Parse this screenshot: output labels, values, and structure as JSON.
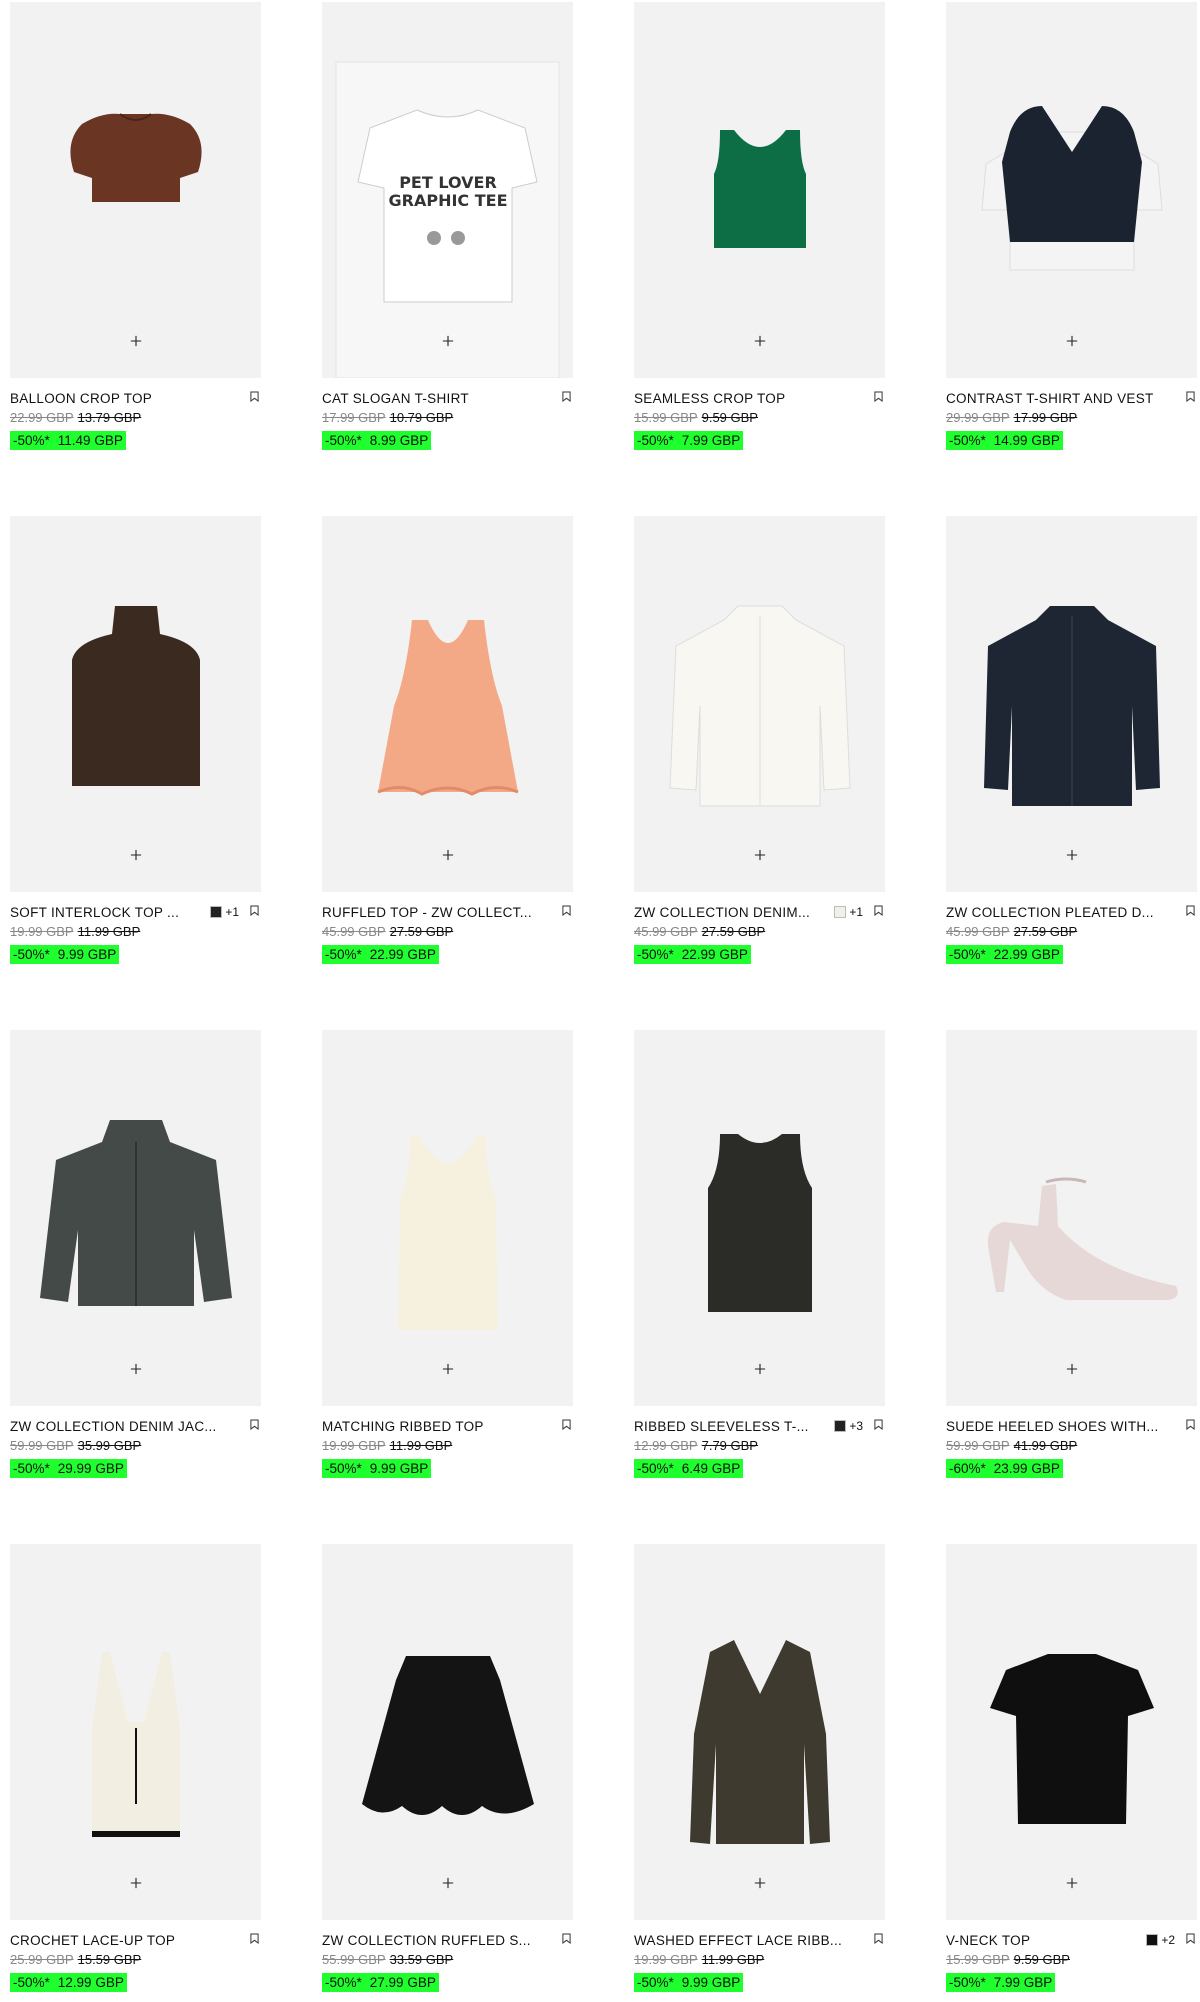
{
  "accent": "#1fff2d",
  "icons": {
    "add": "plus-icon",
    "bookmark": "bookmark-icon"
  },
  "add_label": "+",
  "products": [
    {
      "name": "BALLOON CROP TOP",
      "old1": "22.99 GBP",
      "old2": "13.79 GBP",
      "discount": "-50%*",
      "price": "11.49 GBP",
      "swatch": null,
      "colors": null,
      "art": "crop-top-brown"
    },
    {
      "name": "CAT SLOGAN T-SHIRT",
      "old1": "17.99 GBP",
      "old2": "10.79 GBP",
      "discount": "-50%*",
      "price": "8.99 GBP",
      "swatch": null,
      "colors": null,
      "art": "tshirt-white",
      "art_text": [
        "PET LOVER",
        "GRAPHIC TEE"
      ]
    },
    {
      "name": "SEAMLESS CROP TOP",
      "old1": "15.99 GBP",
      "old2": "9.59 GBP",
      "discount": "-50%*",
      "price": "7.99 GBP",
      "swatch": null,
      "colors": null,
      "art": "tank-green"
    },
    {
      "name": "CONTRAST T-SHIRT AND VEST",
      "old1": "29.99 GBP",
      "old2": "17.99 GBP",
      "discount": "-50%*",
      "price": "14.99 GBP",
      "swatch": null,
      "colors": null,
      "art": "vest-navy"
    },
    {
      "name": "SOFT INTERLOCK TOP ...",
      "old1": "19.99 GBP",
      "old2": "11.99 GBP",
      "discount": "-50%*",
      "price": "9.99 GBP",
      "swatch": "#222",
      "colors": "+1",
      "art": "sleeveless-brown"
    },
    {
      "name": "RUFFLED TOP - ZW COLLECT...",
      "old1": "45.99 GBP",
      "old2": "27.59 GBP",
      "discount": "-50%*",
      "price": "22.99 GBP",
      "swatch": null,
      "colors": null,
      "art": "ruffle-peach"
    },
    {
      "name": "ZW COLLECTION DENIM...",
      "old1": "45.99 GBP",
      "old2": "27.59 GBP",
      "discount": "-50%*",
      "price": "22.99 GBP",
      "swatch": "#f1efe8",
      "colors": "+1",
      "art": "shirt-white"
    },
    {
      "name": "ZW COLLECTION PLEATED D...",
      "old1": "45.99 GBP",
      "old2": "27.59 GBP",
      "discount": "-50%*",
      "price": "22.99 GBP",
      "swatch": null,
      "colors": null,
      "art": "shirt-navy"
    },
    {
      "name": "ZW COLLECTION DENIM JAC...",
      "old1": "59.99 GBP",
      "old2": "35.99 GBP",
      "discount": "-50%*",
      "price": "29.99 GBP",
      "swatch": null,
      "colors": null,
      "art": "jacket-grey"
    },
    {
      "name": "MATCHING RIBBED TOP",
      "old1": "19.99 GBP",
      "old2": "11.99 GBP",
      "discount": "-50%*",
      "price": "9.99 GBP",
      "swatch": null,
      "colors": null,
      "art": "tank-cream"
    },
    {
      "name": "RIBBED SLEEVELESS T-...",
      "old1": "12.99 GBP",
      "old2": "7.79 GBP",
      "discount": "-50%*",
      "price": "6.49 GBP",
      "swatch": "#222",
      "colors": "+3",
      "art": "tank-black"
    },
    {
      "name": "SUEDE HEELED SHOES WITH...",
      "old1": "59.99 GBP",
      "old2": "41.99 GBP",
      "discount": "-60%*",
      "price": "23.99 GBP",
      "swatch": null,
      "colors": null,
      "art": "heel-pink"
    },
    {
      "name": "CROCHET LACE-UP TOP",
      "old1": "25.99 GBP",
      "old2": "15.59 GBP",
      "discount": "-50%*",
      "price": "12.99 GBP",
      "swatch": null,
      "colors": null,
      "art": "crochet-cream"
    },
    {
      "name": "ZW COLLECTION RUFFLED S...",
      "old1": "55.99 GBP",
      "old2": "33.59 GBP",
      "discount": "-50%*",
      "price": "27.99 GBP",
      "swatch": null,
      "colors": null,
      "art": "skirt-black"
    },
    {
      "name": "WASHED EFFECT LACE RIBB...",
      "old1": "19.99 GBP",
      "old2": "11.99 GBP",
      "discount": "-50%*",
      "price": "9.99 GBP",
      "swatch": null,
      "colors": null,
      "art": "longsleeve-olive"
    },
    {
      "name": "V-NECK TOP",
      "old1": "15.99 GBP",
      "old2": "9.59 GBP",
      "discount": "-50%*",
      "price": "7.99 GBP",
      "swatch": "#111",
      "colors": "+2",
      "art": "tee-black"
    }
  ]
}
